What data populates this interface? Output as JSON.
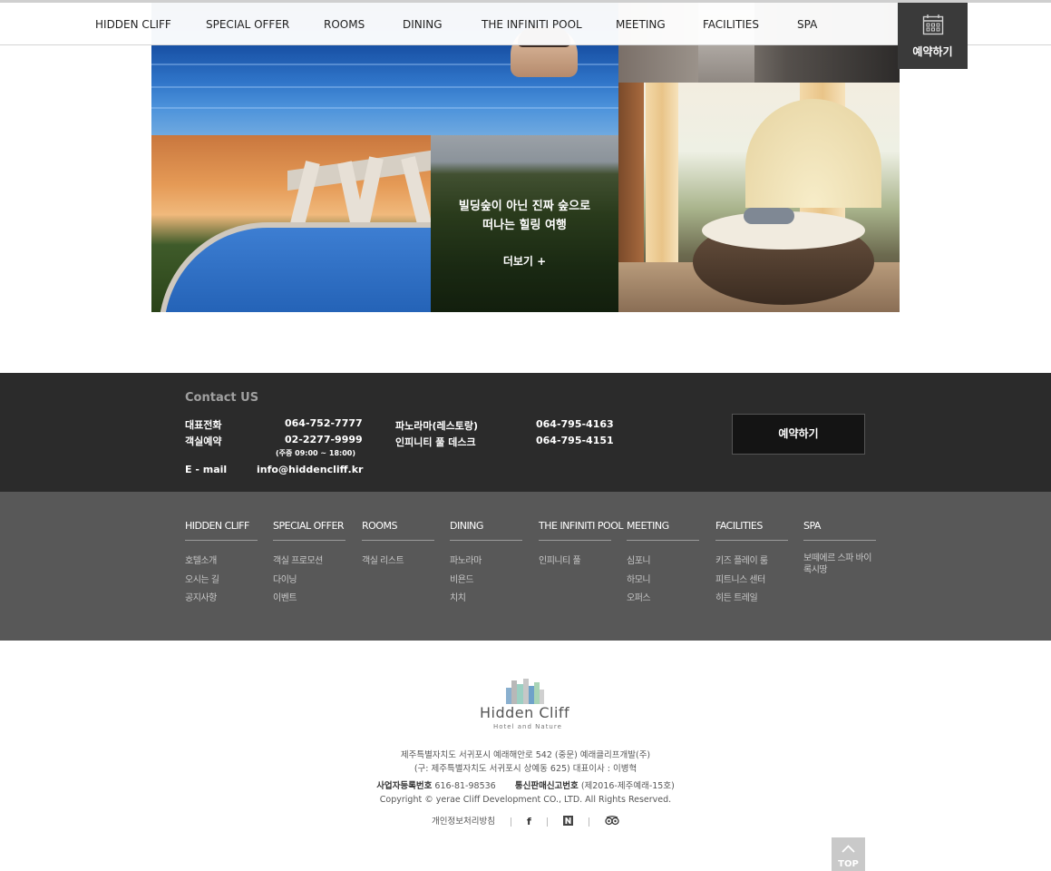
{
  "nav": {
    "items": [
      "HIDDEN CLIFF",
      "SPECIAL OFFER",
      "ROOMS",
      "DINING",
      "THE INFINITI POOL",
      "MEETING",
      "FACILITIES",
      "SPA"
    ],
    "reserve_label": "예약하기",
    "reserve_icon": "calendar-icon"
  },
  "gallery": {
    "caption_line1": "빌딩숲이 아닌 진짜 숲으로",
    "caption_line2": "떠나는 힐링 여행",
    "more_label": "더보기 +"
  },
  "contact": {
    "title": "Contact US",
    "main_phone_label": "대표전화",
    "main_phone": "064-752-7777",
    "room_res_label": "객실예약",
    "room_res_phone": "02-2277-9999",
    "room_res_hours": "(주중 09:00 ~ 18:00)",
    "email_label": "E - mail",
    "email": "info@hiddencliff.kr",
    "panorama_label": "파노라마(레스토랑)",
    "panorama_phone": "064-795-4163",
    "pool_desk_label": "인피니티 풀 데스크",
    "pool_desk_phone": "064-795-4151",
    "reserve_button": "예약하기"
  },
  "sitemap": [
    {
      "head": "HIDDEN CLIFF",
      "links": [
        "호텔소개",
        "오시는 길",
        "공지사항"
      ]
    },
    {
      "head": "SPECIAL OFFER",
      "links": [
        "객실 프로모션",
        "다이닝",
        "이벤트"
      ]
    },
    {
      "head": "ROOMS",
      "links": [
        "객실 리스트"
      ]
    },
    {
      "head": "DINING",
      "links": [
        "파노라마",
        "비욘드",
        "치치"
      ]
    },
    {
      "head": "THE INFINITI POOL",
      "links": [
        "인피니티 풀"
      ]
    },
    {
      "head": "MEETING",
      "links": [
        "심포니",
        "하모니",
        "오퍼스"
      ]
    },
    {
      "head": "FACILITIES",
      "links": [
        "키즈 플레이 룸",
        "피트니스 센터",
        "히든 트레일"
      ]
    },
    {
      "head": "SPA",
      "links": [
        "보떼에르 스파 바이 록시땅"
      ]
    }
  ],
  "footer": {
    "logo_text": "Hidden Cliff",
    "logo_tagline": "Hotel and Nature",
    "address_line": "제주특별자치도 서귀포시 예래해안로 542 (중문) 예래클리프개발(주)",
    "old_address_line": "(구: 제주특별자치도 서귀포시 상예동 625) 대표이사 : 이병혁",
    "biz_reg_label": "사업자등록번호",
    "biz_reg_number": "616-81-98536",
    "ecommerce_label": "통신판매신고번호",
    "ecommerce_number": "(제2016-제주예래-15호)",
    "copyright": "Copyright © yerae Cliff Development CO., LTD. All Rights Reserved.",
    "privacy_link": "개인정보처리방침",
    "social_icons": [
      "facebook-icon",
      "naver-blog-icon",
      "tripadvisor-icon"
    ],
    "top_label": "TOP"
  }
}
